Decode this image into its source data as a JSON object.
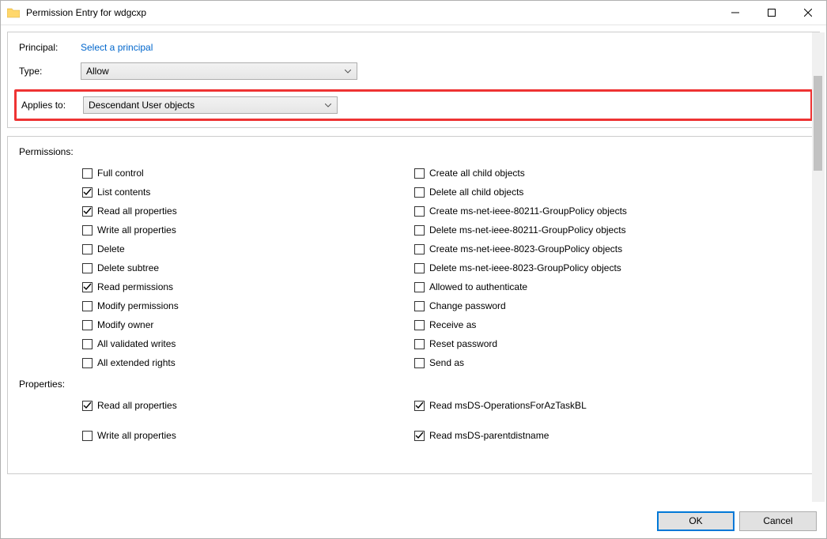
{
  "window": {
    "title": "Permission Entry for wdgcxp"
  },
  "top": {
    "principal_label": "Principal:",
    "principal_link": "Select a principal",
    "type_label": "Type:",
    "type_value": "Allow",
    "applies_label": "Applies to:",
    "applies_value": "Descendant User objects"
  },
  "permissions": {
    "header": "Permissions:",
    "left": [
      {
        "label": "Full control",
        "checked": false
      },
      {
        "label": "List contents",
        "checked": true
      },
      {
        "label": "Read all properties",
        "checked": true
      },
      {
        "label": "Write all properties",
        "checked": false
      },
      {
        "label": "Delete",
        "checked": false
      },
      {
        "label": "Delete subtree",
        "checked": false
      },
      {
        "label": "Read permissions",
        "checked": true
      },
      {
        "label": "Modify permissions",
        "checked": false
      },
      {
        "label": "Modify owner",
        "checked": false
      },
      {
        "label": "All validated writes",
        "checked": false
      },
      {
        "label": "All extended rights",
        "checked": false
      }
    ],
    "right": [
      {
        "label": "Create all child objects",
        "checked": false
      },
      {
        "label": "Delete all child objects",
        "checked": false
      },
      {
        "label": "Create ms-net-ieee-80211-GroupPolicy objects",
        "checked": false
      },
      {
        "label": "Delete ms-net-ieee-80211-GroupPolicy objects",
        "checked": false
      },
      {
        "label": "Create ms-net-ieee-8023-GroupPolicy objects",
        "checked": false
      },
      {
        "label": "Delete ms-net-ieee-8023-GroupPolicy objects",
        "checked": false
      },
      {
        "label": "Allowed to authenticate",
        "checked": false
      },
      {
        "label": "Change password",
        "checked": false
      },
      {
        "label": "Receive as",
        "checked": false
      },
      {
        "label": "Reset password",
        "checked": false
      },
      {
        "label": "Send as",
        "checked": false
      }
    ]
  },
  "properties": {
    "header": "Properties:",
    "left": [
      {
        "label": "Read all properties",
        "checked": true
      },
      {
        "label": "Write all properties",
        "checked": false
      }
    ],
    "right": [
      {
        "label": "Read msDS-OperationsForAzTaskBL",
        "checked": true
      },
      {
        "label": "Read msDS-parentdistname",
        "checked": true
      }
    ]
  },
  "footer": {
    "ok": "OK",
    "cancel": "Cancel"
  }
}
